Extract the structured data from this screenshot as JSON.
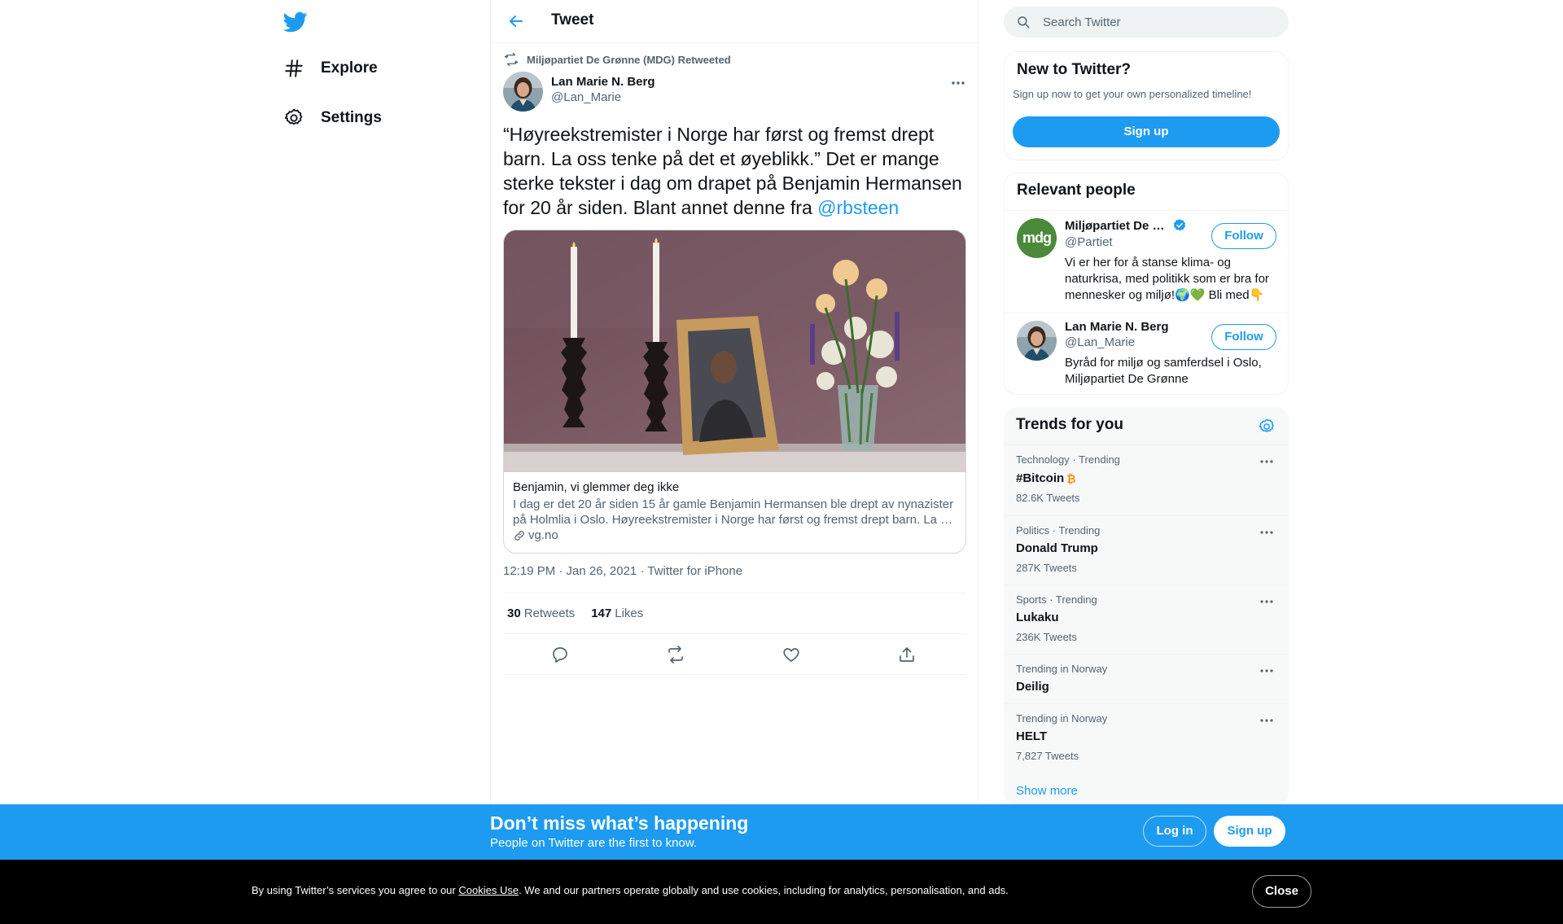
{
  "nav": {
    "items": [
      {
        "label": "Explore",
        "icon": "hashtag-icon"
      },
      {
        "label": "Settings",
        "icon": "gear-icon"
      }
    ]
  },
  "header": {
    "title": "Tweet"
  },
  "tweet": {
    "retweeted_by": "Miljøpartiet De Grønne (MDG) Retweeted",
    "author_name": "Lan Marie N. Berg",
    "author_handle": "@Lan_Marie",
    "text": "“Høyreekstremister i Norge har først og fremst drept barn. La oss tenke på det et øyeblikk.” Det er mange sterke tekster i dag om drapet på Benjamin Hermansen for 20 år siden. Blant annet denne fra ",
    "mention": "@rbsteen",
    "card": {
      "title": "Benjamin, vi glemmer deg ikke",
      "description": "I dag er det 20 år siden 15 år gamle Benjamin Hermansen ble drept av nynazister på Holmlia i Oslo. Høyreekstremister i Norge har først og fremst drept barn. La …",
      "domain": "vg.no"
    },
    "timestamp": "12:19 PM · Jan 26, 2021",
    "source": "Twitter for iPhone",
    "retweets_count": "30",
    "retweets_label": "Retweets",
    "likes_count": "147",
    "likes_label": "Likes"
  },
  "search": {
    "placeholder": "Search Twitter"
  },
  "new_to_twitter": {
    "title": "New to Twitter?",
    "subtitle": "Sign up now to get your own personalized timeline!",
    "signup_label": "Sign up"
  },
  "relevant_people": {
    "title": "Relevant people",
    "people": [
      {
        "name": "Miljøpartiet De Gr…",
        "handle": "@Partiet",
        "bio": "Vi er her for å stanse klima- og naturkrisa, med politikk som er bra for mennesker og miljø!🌍💚 Bli med👇",
        "follow_label": "Follow",
        "avatar_text": "mdg",
        "verified": true
      },
      {
        "name": "Lan Marie N. Berg",
        "handle": "@Lan_Marie",
        "bio": "Byråd for miljø og samferdsel i Oslo, Miljøpartiet De Grønne",
        "follow_label": "Follow",
        "verified": false
      }
    ]
  },
  "trends": {
    "title": "Trends for you",
    "items": [
      {
        "category": "Technology · Trending",
        "name": "#Bitcoin",
        "count": "82.6K Tweets",
        "emoji": "₿"
      },
      {
        "category": "Politics · Trending",
        "name": "Donald Trump",
        "count": "287K Tweets"
      },
      {
        "category": "Sports · Trending",
        "name": "Lukaku",
        "count": "236K Tweets"
      },
      {
        "category": "Trending in Norway",
        "name": "Deilig",
        "count": ""
      },
      {
        "category": "Trending in Norway",
        "name": "HELT",
        "count": "7,827 Tweets"
      }
    ],
    "show_more": "Show more"
  },
  "banner": {
    "title": "Don’t miss what’s happening",
    "subtitle": "People on Twitter are the first to know.",
    "login_label": "Log in",
    "signup_label": "Sign up"
  },
  "cookie": {
    "text_before": "By using Twitter’s services you agree to our ",
    "link": "Cookies Use",
    "text_after": ". We and our partners operate globally and use cookies, including for analytics, personalisation, and ads.",
    "close_label": "Close"
  },
  "colors": {
    "brand": "#1d9bf0",
    "text": "#0f1419",
    "muted": "#536471",
    "mdg_green": "#4a8a3a"
  }
}
